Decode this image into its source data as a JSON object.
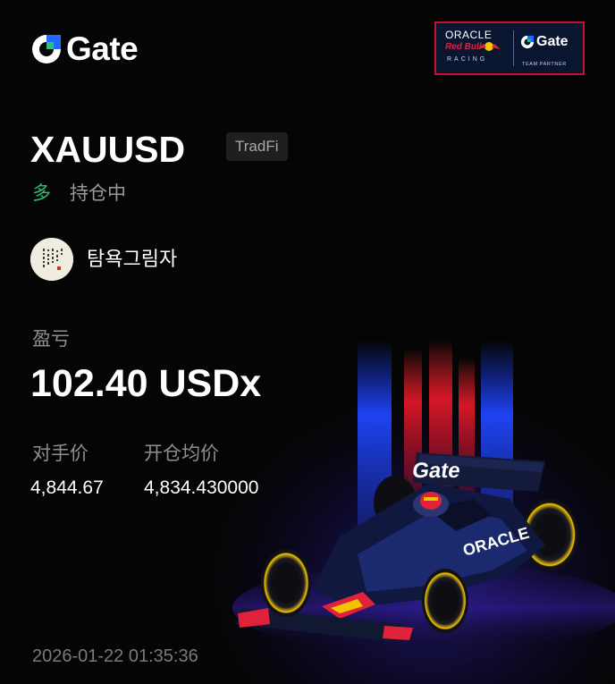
{
  "brand": {
    "name": "Gate",
    "accent_blue": "#1f6bff",
    "accent_green": "#2ebd7a"
  },
  "partner": {
    "oracle": "ORACLE",
    "redbull": "Red Bull",
    "racing": "RACING",
    "gate": "Gate",
    "team_partner": "TEAM PARTNER",
    "border_color": "#c8102e"
  },
  "position": {
    "symbol": "XAUUSD",
    "tag": "TradFi",
    "side": "多",
    "status": "持仓中"
  },
  "user": {
    "name": "탐욕그림자",
    "avatar_icon": "calligraphy-avatar-icon"
  },
  "pnl": {
    "label": "盈亏",
    "value": "102.40 USDx"
  },
  "prices": {
    "counter_label": "对手价",
    "counter_value": "4,844.67",
    "entry_label": "开仓均价",
    "entry_value": "4,834.430000"
  },
  "timestamp": "2026-01-22 01:35:36",
  "artwork": {
    "wing_text": "Gate",
    "sidepod_text": "ORACLE"
  }
}
